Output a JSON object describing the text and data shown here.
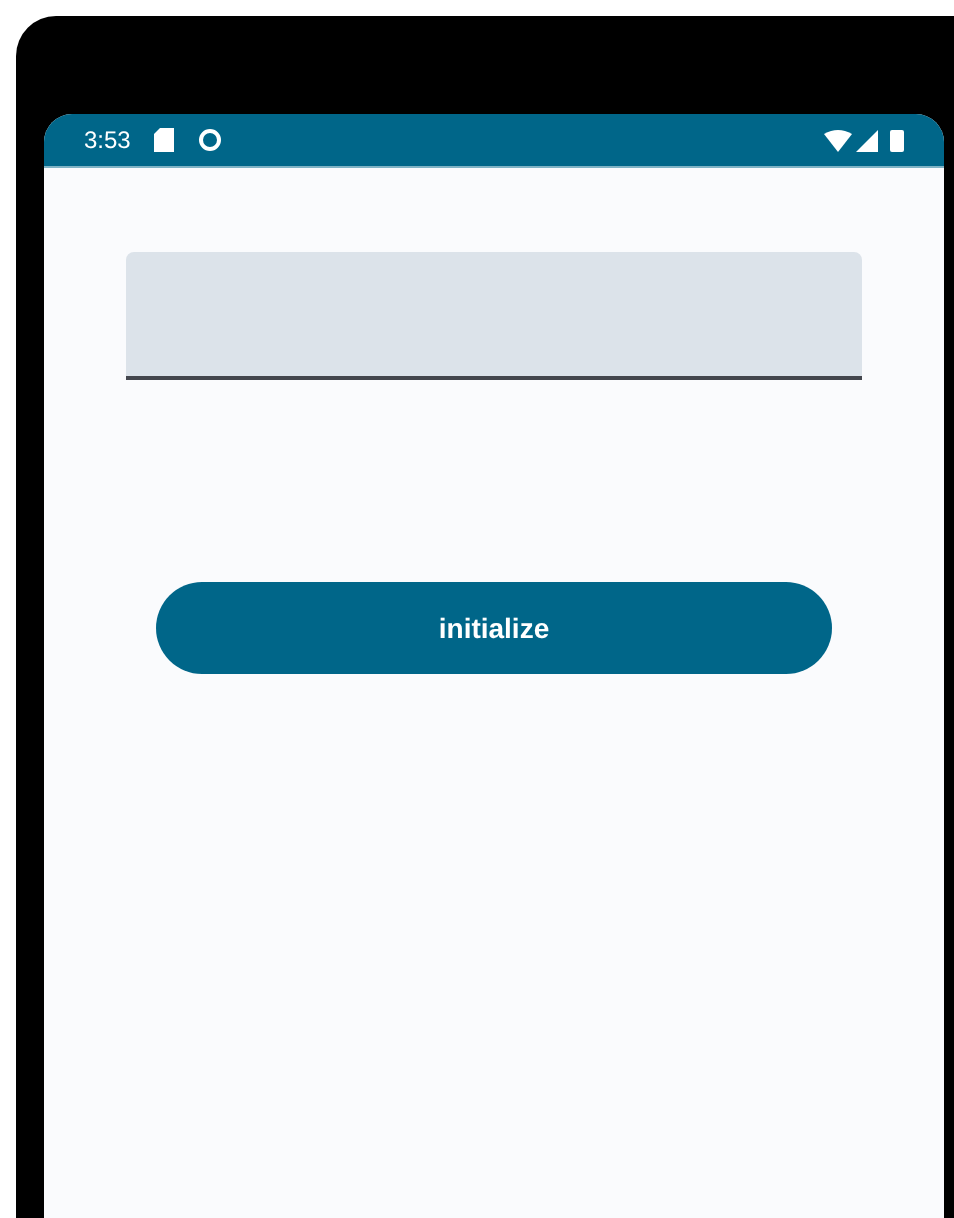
{
  "status_bar": {
    "time": "3:53"
  },
  "button": {
    "label": "initialize"
  }
}
